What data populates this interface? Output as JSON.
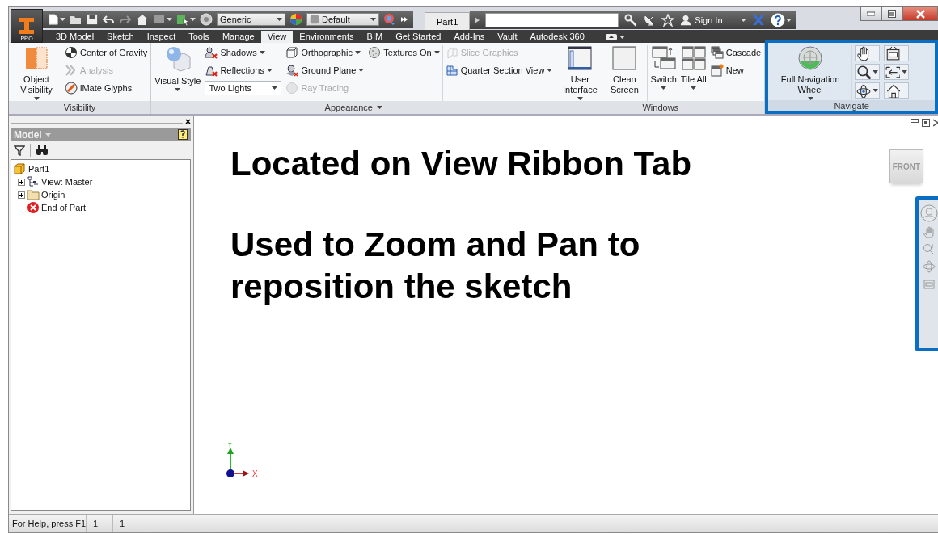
{
  "app_button": {
    "badge": "PRO"
  },
  "quick_access": {
    "combos": [
      {
        "value": "Generic"
      },
      {
        "value": "Default"
      }
    ]
  },
  "document_tab": "Part1",
  "sign_in": "Sign In",
  "ribbon_tabs": [
    {
      "label": "3D Model",
      "selected": false
    },
    {
      "label": "Sketch",
      "selected": false
    },
    {
      "label": "Inspect",
      "selected": false
    },
    {
      "label": "Tools",
      "selected": false
    },
    {
      "label": "Manage",
      "selected": false
    },
    {
      "label": "View",
      "selected": true
    },
    {
      "label": "Environments",
      "selected": false
    },
    {
      "label": "BIM",
      "selected": false
    },
    {
      "label": "Get Started",
      "selected": false
    },
    {
      "label": "Add-Ins",
      "selected": false
    },
    {
      "label": "Vault",
      "selected": false
    },
    {
      "label": "Autodesk 360",
      "selected": false
    }
  ],
  "panels": [
    {
      "title": "Visibility",
      "menu": false,
      "highlighted": false,
      "groups": [
        {
          "columns": [
            {
              "items": [
                {
                  "kind": "large",
                  "label": "Object Visibility",
                  "dropdown": true,
                  "disabled": false
                }
              ]
            },
            {
              "items": [
                {
                  "kind": "small",
                  "label": "Center of Gravity",
                  "dropdown": false,
                  "disabled": false
                },
                {
                  "kind": "small",
                  "label": "Analysis",
                  "dropdown": false,
                  "disabled": true
                },
                {
                  "kind": "small",
                  "label": "iMate Glyphs",
                  "dropdown": false,
                  "disabled": false
                }
              ]
            }
          ]
        }
      ]
    },
    {
      "title": "Appearance",
      "menu": true,
      "highlighted": false,
      "groups": [
        {
          "columns": [
            {
              "items": [
                {
                  "kind": "large",
                  "label": "Visual Style",
                  "dropdown": true,
                  "disabled": false
                }
              ]
            },
            {
              "items": [
                {
                  "kind": "small",
                  "label": "Shadows",
                  "dropdown": true,
                  "disabled": false
                },
                {
                  "kind": "small",
                  "label": "Reflections",
                  "dropdown": true,
                  "disabled": false
                },
                {
                  "kind": "combo",
                  "label": "Two Lights",
                  "dropdown": true,
                  "disabled": false
                }
              ]
            },
            {
              "items": [
                {
                  "kind": "small",
                  "label": "Orthographic",
                  "dropdown": true,
                  "disabled": false
                },
                {
                  "kind": "small",
                  "label": "Ground Plane",
                  "dropdown": true,
                  "disabled": false
                },
                {
                  "kind": "small",
                  "label": "Ray Tracing",
                  "dropdown": false,
                  "disabled": true
                }
              ]
            },
            {
              "items": [
                {
                  "kind": "small",
                  "label": "Textures On",
                  "dropdown": true,
                  "disabled": false
                }
              ]
            }
          ]
        },
        {
          "columns": [
            {
              "items": [
                {
                  "kind": "small",
                  "label": "Slice Graphics",
                  "dropdown": false,
                  "disabled": true
                },
                {
                  "kind": "small",
                  "label": "Quarter Section View",
                  "dropdown": true,
                  "disabled": false
                }
              ]
            }
          ]
        }
      ]
    },
    {
      "title": "Windows",
      "menu": false,
      "highlighted": false,
      "groups": [
        {
          "columns": [
            {
              "items": [
                {
                  "kind": "large",
                  "label": "User Interface",
                  "dropdown": true,
                  "disabled": false
                }
              ]
            },
            {
              "items": [
                {
                  "kind": "large",
                  "label": "Clean Screen",
                  "dropdown": false,
                  "disabled": false
                }
              ]
            }
          ]
        },
        {
          "columns": [
            {
              "items": [
                {
                  "kind": "large",
                  "label": "Switch",
                  "dropdown": true,
                  "disabled": false
                }
              ]
            },
            {
              "items": [
                {
                  "kind": "large",
                  "label": "Tile All",
                  "dropdown": true,
                  "disabled": false
                }
              ]
            },
            {
              "items": [
                {
                  "kind": "small",
                  "label": "Cascade",
                  "dropdown": false,
                  "disabled": false
                },
                {
                  "kind": "small",
                  "label": "New",
                  "dropdown": false,
                  "disabled": false
                }
              ]
            }
          ]
        }
      ]
    },
    {
      "title": "Navigate",
      "menu": false,
      "highlighted": true,
      "groups": [
        {
          "columns": [
            {
              "items": [
                {
                  "kind": "large",
                  "label": "Full Navigation Wheel",
                  "dropdown": true,
                  "disabled": false
                }
              ]
            }
          ]
        },
        {
          "columns": [
            {
              "items": [
                {
                  "kind": "icon",
                  "dropdown": false
                },
                {
                  "kind": "icon",
                  "dropdown": true
                },
                {
                  "kind": "icon",
                  "dropdown": true
                }
              ]
            },
            {
              "items": [
                {
                  "kind": "icon",
                  "dropdown": false
                },
                {
                  "kind": "icon",
                  "dropdown": true
                },
                {
                  "kind": "icon",
                  "dropdown": false
                }
              ]
            }
          ]
        }
      ]
    }
  ],
  "browser": {
    "title": "Model",
    "tree": [
      {
        "label": "Part1",
        "children": [
          {
            "label": "View: Master",
            "expandable": true
          },
          {
            "label": "Origin",
            "expandable": true
          },
          {
            "label": "End of Part",
            "expandable": false
          }
        ]
      }
    ]
  },
  "viewport": {
    "annotations": [
      "Located on View Ribbon Tab",
      "Used to Zoom and Pan to reposition the sketch"
    ],
    "viewcube": {
      "face": "FRONT"
    },
    "nav_bar": {
      "highlighted": true
    },
    "triad": {
      "x": "X",
      "y": "Y"
    }
  },
  "status_bar": {
    "help": "For Help, press F1",
    "fields": [
      "1",
      "1"
    ]
  }
}
